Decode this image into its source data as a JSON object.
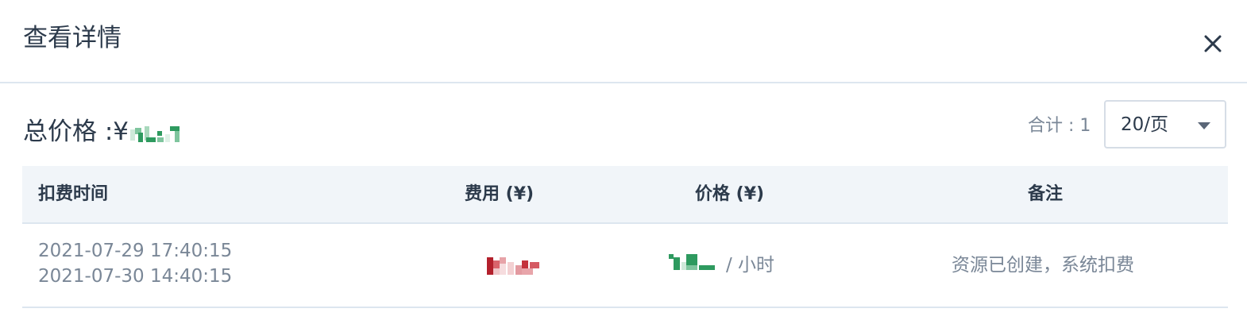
{
  "dialog": {
    "title": "查看详情",
    "close_icon": "close-icon"
  },
  "summary": {
    "total_price_label": "总价格 :¥",
    "count_text": "合计 : 1",
    "page_size": "20/页",
    "dropdown_icon": "caret-down-icon"
  },
  "table": {
    "columns": [
      "扣费时间",
      "费用 (¥)",
      "价格 (¥)",
      "备注"
    ],
    "rows": [
      {
        "time_start": "2021-07-29 17:40:15",
        "time_end": "2021-07-30 14:40:15",
        "price_unit": "/ 小时",
        "remark": "资源已创建，系统扣费"
      }
    ]
  },
  "colors": {
    "accent_green": "#2e9a5f",
    "fee_red": "#c4323c",
    "border": "#dde6ef",
    "header_bg": "#f1f5f9"
  }
}
